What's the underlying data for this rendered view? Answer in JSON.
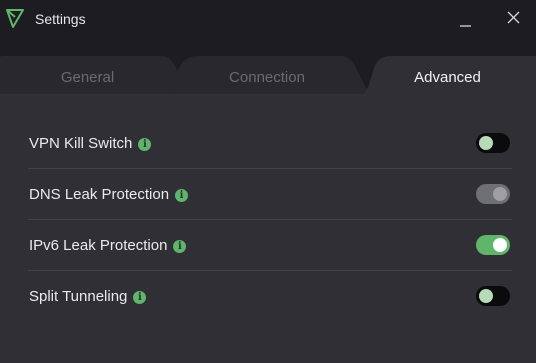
{
  "window": {
    "title": "Settings",
    "logo_icon": "protonvpn-triangle-icon",
    "accent_color": "#5fb56a"
  },
  "tabs": [
    {
      "label": "General",
      "active": false
    },
    {
      "label": "Connection",
      "active": false
    },
    {
      "label": "Advanced",
      "active": true
    }
  ],
  "settings": [
    {
      "label": "VPN Kill Switch",
      "info_icon": "info-icon",
      "toggle": "off"
    },
    {
      "label": "DNS Leak Protection",
      "info_icon": "info-icon",
      "toggle": "on-disabled"
    },
    {
      "label": "IPv6 Leak Protection",
      "info_icon": "info-icon",
      "toggle": "on"
    },
    {
      "label": "Split Tunneling",
      "info_icon": "info-icon",
      "toggle": "off"
    }
  ]
}
